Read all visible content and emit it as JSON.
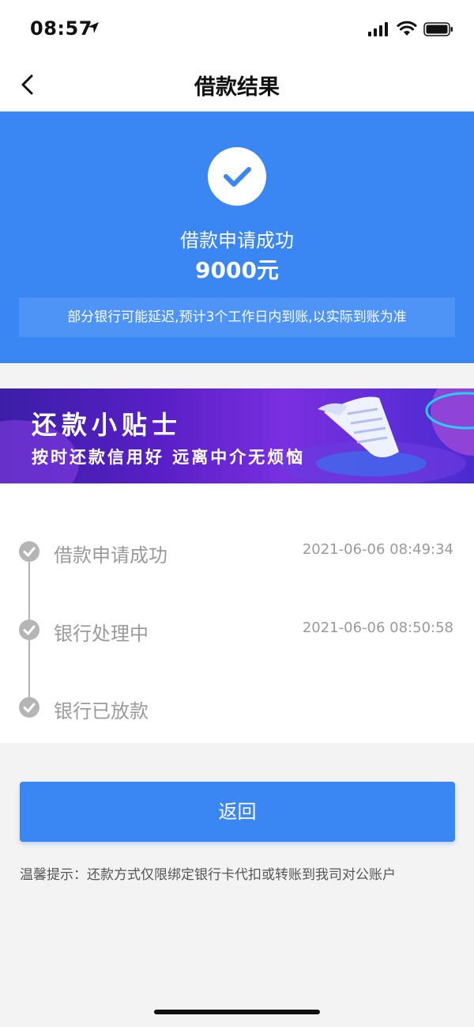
{
  "status_bar": {
    "time": "08:57"
  },
  "nav": {
    "title": "借款结果"
  },
  "hero": {
    "title": "借款申请成功",
    "amount": "9000元",
    "note": "部分银行可能延迟,预计3个工作日内到账,以实际到账为准"
  },
  "banner": {
    "title": "还款小贴士",
    "subtitle": "按时还款信用好 远离中介无烦恼"
  },
  "timeline": [
    {
      "label": "借款申请成功",
      "time": "2021-06-06 08:49:34"
    },
    {
      "label": "银行处理中",
      "time": "2021-06-06 08:50:58"
    },
    {
      "label": "银行已放款",
      "time": ""
    }
  ],
  "actions": {
    "return_label": "返回"
  },
  "tip": "温馨提示：还款方式仅限绑定银行卡代扣或转账到我司对公账户",
  "colors": {
    "primary": "#3a86f2",
    "timeline_gray": "#b5b5b5"
  }
}
